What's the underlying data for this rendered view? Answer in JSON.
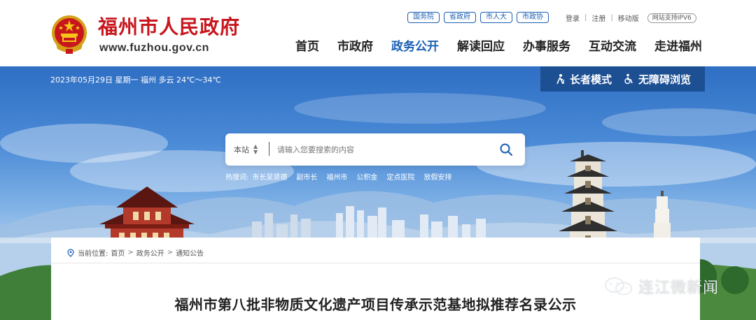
{
  "header": {
    "site_title": "福州市人民政府",
    "site_url": "www.fuzhou.gov.cn",
    "gov_links": [
      "国务院",
      "省政府",
      "市人大",
      "市政协"
    ],
    "top_links": [
      "登录",
      "注册",
      "移动版"
    ],
    "ipv6_badge": "网站支持IPV6",
    "nav": [
      {
        "label": "首页",
        "active": false
      },
      {
        "label": "市政府",
        "active": false
      },
      {
        "label": "政务公开",
        "active": true
      },
      {
        "label": "解读回应",
        "active": false
      },
      {
        "label": "办事服务",
        "active": false
      },
      {
        "label": "互动交流",
        "active": false
      },
      {
        "label": "走进福州",
        "active": false
      }
    ]
  },
  "banner": {
    "date_weather": "2023年05月29日 星期一  福州 多云 24℃～34℃",
    "elder_mode": "长者模式",
    "accessibility": "无障碍浏览",
    "search": {
      "scope": "本站",
      "placeholder": "请输入您要搜索的内容"
    },
    "hot_search_label": "热搜词:",
    "hot_search_items": [
      "市长吴贤德",
      "副市长",
      "福州市",
      "公积金",
      "定点医院",
      "放假安排"
    ]
  },
  "content": {
    "breadcrumb_label": "当前位置:",
    "breadcrumb": [
      "首页",
      "政务公开",
      "通知公告"
    ],
    "article_title": "福州市第八批非物质文化遗产项目传承示范基地拟推荐名录公示"
  },
  "watermark": {
    "text": "连江微新闻"
  },
  "colors": {
    "brand_red": "#c8161d",
    "nav_active": "#1a5fb4",
    "access_bar": "#1d4f93"
  }
}
